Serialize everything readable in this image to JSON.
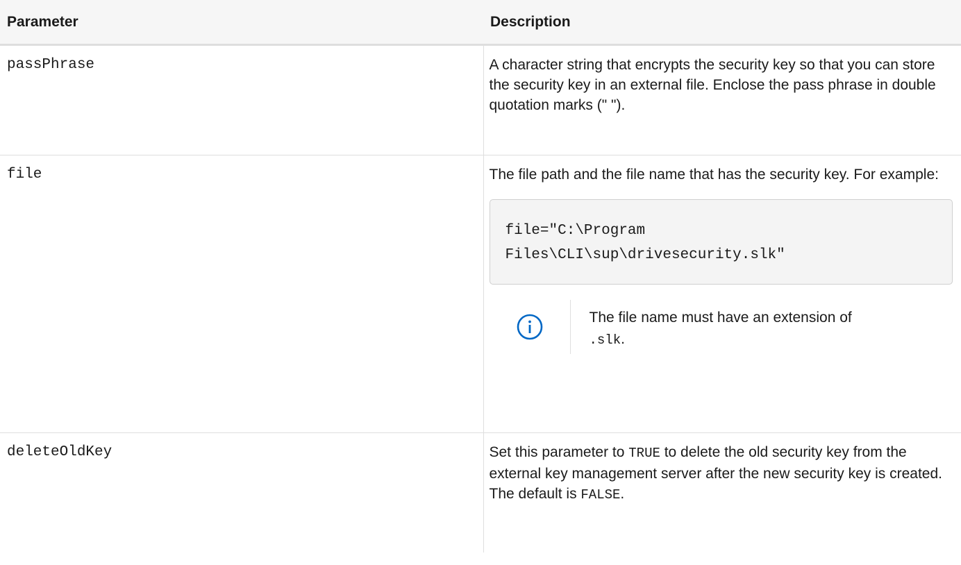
{
  "table": {
    "headers": {
      "parameter": "Parameter",
      "description": "Description"
    },
    "rows": [
      {
        "parameter": "passPhrase",
        "description": "A character string that encrypts the security key so that you can store the security key in an external file. Enclose the pass phrase in double quotation marks (\" \")."
      },
      {
        "parameter": "file",
        "description": "The file path and the file name that has the security key. For example:",
        "code_line1": "file=\"C:\\Program",
        "code_line2": "Files\\CLI\\sup\\drivesecurity.slk\"",
        "note_icon": "info-circle-icon",
        "note_text_before": "The file name must have an extension of ",
        "note_code": ".slk",
        "note_text_after": "."
      },
      {
        "parameter": "deleteOldKey",
        "desc_before": "Set this parameter to ",
        "desc_code1": "TRUE",
        "desc_middle": " to delete the old security key from the external key management server after the new security key is created. The default is ",
        "desc_code2": "FALSE",
        "desc_after": "."
      }
    ]
  },
  "colors": {
    "info_icon": "#0067c5",
    "header_bg": "#f6f6f6",
    "border": "#dedede",
    "code_bg": "#f4f4f4"
  }
}
